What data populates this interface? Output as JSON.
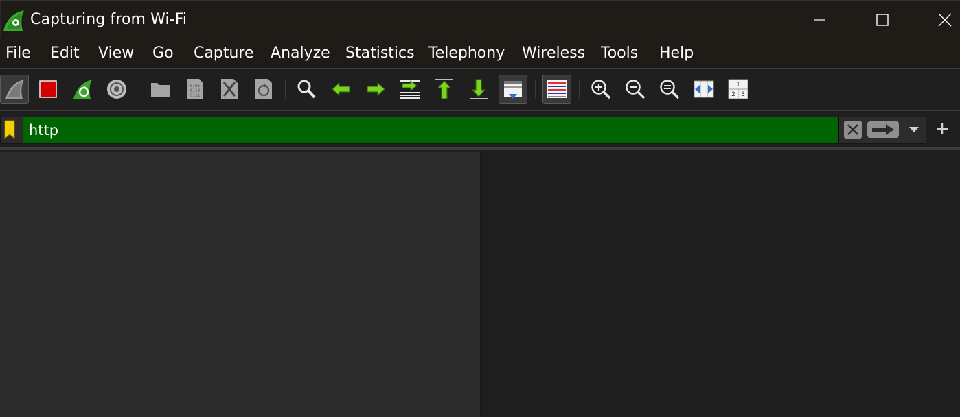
{
  "window": {
    "title": "Capturing from Wi-Fi",
    "controls": [
      "minimize",
      "maximize",
      "close"
    ]
  },
  "menu": [
    {
      "label": "File",
      "accel": "F",
      "rest": "ile"
    },
    {
      "label": "Edit",
      "accel": "E",
      "rest": "dit"
    },
    {
      "label": "View",
      "accel": "V",
      "rest": "iew"
    },
    {
      "label": "Go",
      "accel": "G",
      "rest": "o"
    },
    {
      "label": "Capture",
      "accel": "C",
      "rest": "apture"
    },
    {
      "label": "Analyze",
      "accel": "A",
      "rest": "nalyze"
    },
    {
      "label": "Statistics",
      "accel": "S",
      "rest": "tatistics"
    },
    {
      "label": "Telephony",
      "accel": "",
      "rest": "Telephony",
      "accel_after": "y"
    },
    {
      "label": "Wireless",
      "accel": "W",
      "rest": "ireless"
    },
    {
      "label": "Tools",
      "accel": "T",
      "rest": "ools"
    },
    {
      "label": "Help",
      "accel": "H",
      "rest": "elp"
    }
  ],
  "toolbar": {
    "buttons": [
      "start-capture-icon",
      "stop-capture-icon",
      "restart-capture-icon",
      "capture-options-icon",
      "open-file-icon",
      "save-file-icon",
      "close-file-icon",
      "reload-file-icon",
      "find-packet-icon",
      "go-back-icon",
      "go-forward-icon",
      "go-to-packet-icon",
      "first-packet-icon",
      "last-packet-icon",
      "auto-scroll-icon",
      "colorize-icon",
      "zoom-in-icon",
      "zoom-out-icon",
      "normal-size-icon",
      "resize-columns-icon",
      "layout-icon"
    ]
  },
  "filter": {
    "value": "http",
    "valid_color": "#006400"
  },
  "colors": {
    "titlebar": "#1f1b17",
    "accent_green": "#006400",
    "stop_red": "#d40000",
    "shark_green": "#3aa72c"
  }
}
